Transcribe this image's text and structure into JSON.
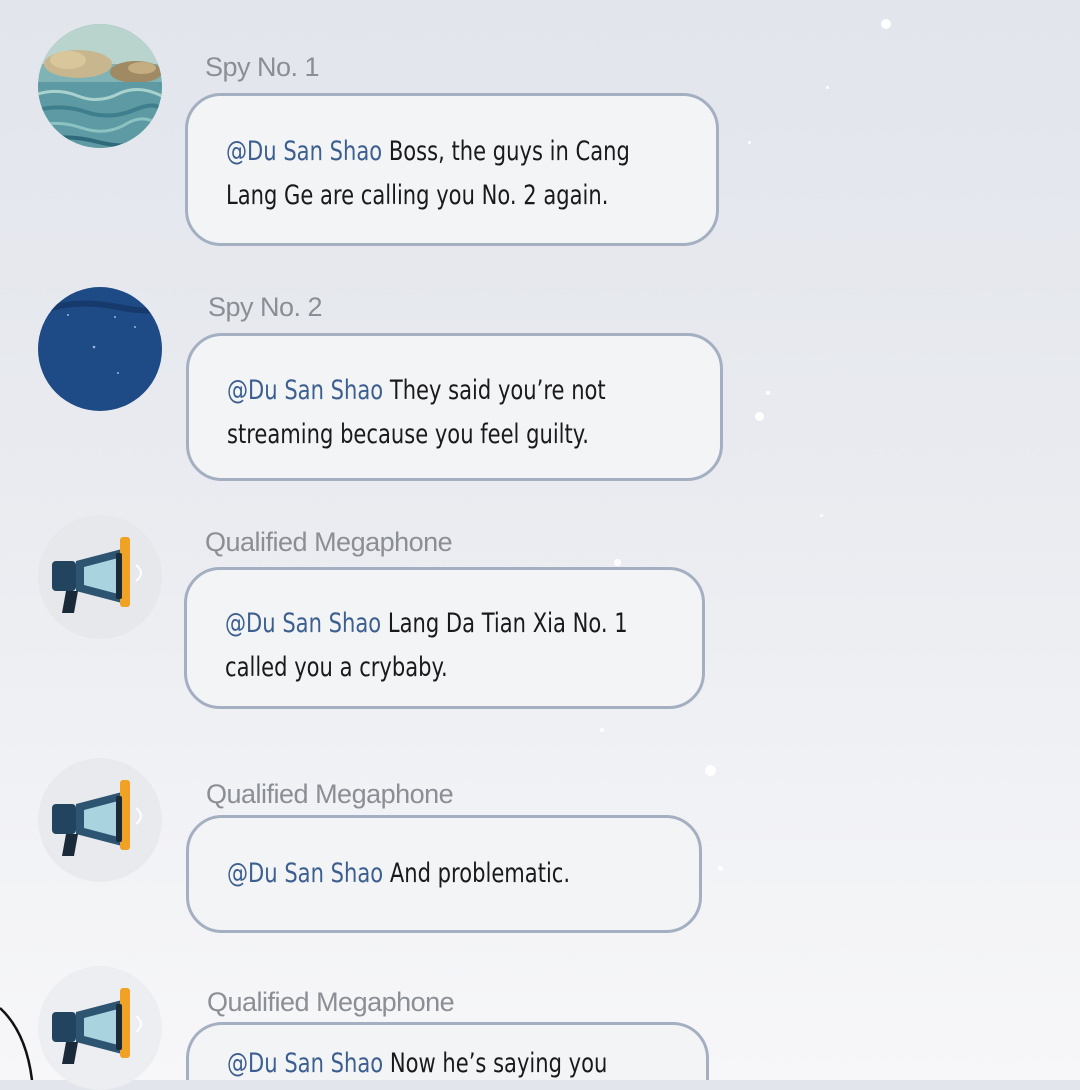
{
  "messages": [
    {
      "sender": "Spy No. 1",
      "avatar": "sea-rocks-avatar",
      "mention": "@Du San Shao",
      "lines": [
        " Boss, the guys in Cang",
        "Lang Ge are calling you No. 2 again."
      ]
    },
    {
      "sender": "Spy No. 2",
      "avatar": "night-sky-avatar",
      "mention": "@Du San Shao",
      "lines": [
        " They said you’re not",
        "streaming because you feel guilty."
      ]
    },
    {
      "sender": "Qualified Megaphone",
      "avatar": "megaphone-avatar",
      "mention": "@Du San Shao",
      "lines": [
        " Lang Da Tian Xia No. 1",
        "called you a crybaby."
      ]
    },
    {
      "sender": "Qualified Megaphone",
      "avatar": "megaphone-avatar",
      "mention": "@Du San Shao",
      "lines": [
        " And problematic."
      ]
    },
    {
      "sender": "Qualified Megaphone",
      "avatar": "megaphone-avatar",
      "mention": "@Du San Shao",
      "lines": [
        " Now he’s saying you"
      ]
    }
  ],
  "colors": {
    "mention": "#3d5f8f",
    "bubble_border": "#a4b0c2",
    "sender": "#8b8e94"
  }
}
